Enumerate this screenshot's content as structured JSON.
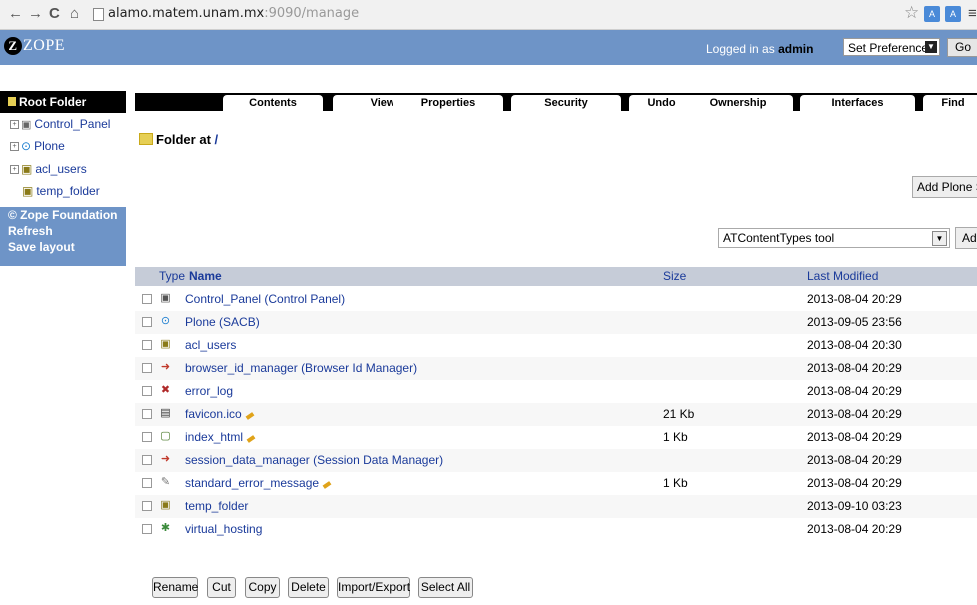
{
  "browser": {
    "url_host": "alamo.matem.unam.mx",
    "url_path": ":9090/manage",
    "back": "←",
    "forward": "→",
    "reload": "C",
    "home": "⌂"
  },
  "zope": {
    "logo": "ZOPE",
    "logged_in_prefix": "Logged in as ",
    "user": "admin",
    "preferences": "Set Preferences",
    "go": "Go"
  },
  "tree": {
    "root": "Root Folder",
    "items": [
      "Control_Panel",
      "Plone",
      "acl_users",
      "temp_folder"
    ],
    "copyright": "© Zope Foundation",
    "refresh": "Refresh",
    "save_layout": "Save layout"
  },
  "tabs": [
    "Contents",
    "View",
    "Properties",
    "Security",
    "Undo",
    "Ownership",
    "Interfaces",
    "Find"
  ],
  "folder": {
    "label": "Folder at",
    "path": "/"
  },
  "add_plone": "Add Plone Site",
  "type_select": "ATContentTypes tool",
  "add_button": "Add",
  "columns": {
    "type": "Type",
    "name": "Name",
    "size": "Size",
    "modified": "Last Modified"
  },
  "rows": [
    {
      "name": "Control_Panel (Control Panel)",
      "size": "",
      "date": "2013-08-04 20:29",
      "icon": "control-panel-icon",
      "pencil": false
    },
    {
      "name": "Plone (SACB)",
      "size": "",
      "date": "2013-09-05 23:56",
      "icon": "plone-icon",
      "pencil": false
    },
    {
      "name": "acl_users",
      "size": "",
      "date": "2013-08-04 20:30",
      "icon": "users-icon",
      "pencil": false
    },
    {
      "name": "browser_id_manager (Browser Id Manager)",
      "size": "",
      "date": "2013-08-04 20:29",
      "icon": "id-manager-icon",
      "pencil": false
    },
    {
      "name": "error_log",
      "size": "",
      "date": "2013-08-04 20:29",
      "icon": "error-icon",
      "pencil": false
    },
    {
      "name": "favicon.ico",
      "size": "21 Kb",
      "date": "2013-08-04 20:29",
      "icon": "image-file-icon",
      "pencil": true
    },
    {
      "name": "index_html",
      "size": "1 Kb",
      "date": "2013-08-04 20:29",
      "icon": "page-template-icon",
      "pencil": true
    },
    {
      "name": "session_data_manager (Session Data Manager)",
      "size": "",
      "date": "2013-08-04 20:29",
      "icon": "session-manager-icon",
      "pencil": false
    },
    {
      "name": "standard_error_message",
      "size": "1 Kb",
      "date": "2013-08-04 20:29",
      "icon": "dtml-method-icon",
      "pencil": true
    },
    {
      "name": "temp_folder",
      "size": "",
      "date": "2013-09-10 03:23",
      "icon": "temp-folder-icon",
      "pencil": false
    },
    {
      "name": "virtual_hosting",
      "size": "",
      "date": "2013-08-04 20:29",
      "icon": "virtual-host-icon",
      "pencil": false
    }
  ],
  "actions": [
    "Rename",
    "Cut",
    "Copy",
    "Delete",
    "Import/Export",
    "Select All"
  ]
}
